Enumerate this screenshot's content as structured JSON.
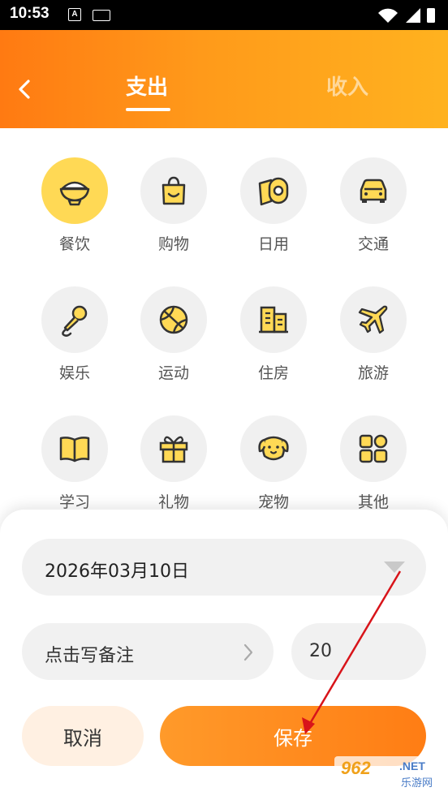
{
  "status_bar": {
    "time": "10:53",
    "a_icon": "A"
  },
  "header": {
    "tabs": [
      {
        "label": "支出",
        "active": true
      },
      {
        "label": "收入",
        "active": false
      }
    ]
  },
  "categories": [
    {
      "label": "餐饮",
      "icon": "rice-bowl-icon",
      "selected": true
    },
    {
      "label": "购物",
      "icon": "shopping-bag-icon",
      "selected": false
    },
    {
      "label": "日用",
      "icon": "toilet-paper-icon",
      "selected": false
    },
    {
      "label": "交通",
      "icon": "car-icon",
      "selected": false
    },
    {
      "label": "娱乐",
      "icon": "microphone-icon",
      "selected": false
    },
    {
      "label": "运动",
      "icon": "basketball-icon",
      "selected": false
    },
    {
      "label": "住房",
      "icon": "building-icon",
      "selected": false
    },
    {
      "label": "旅游",
      "icon": "airplane-icon",
      "selected": false
    },
    {
      "label": "学习",
      "icon": "book-icon",
      "selected": false
    },
    {
      "label": "礼物",
      "icon": "gift-icon",
      "selected": false
    },
    {
      "label": "宠物",
      "icon": "dog-icon",
      "selected": false
    },
    {
      "label": "其他",
      "icon": "grid-icon",
      "selected": false
    }
  ],
  "form": {
    "date": "2026年03月10日",
    "note_placeholder": "点击写备注",
    "amount": "20",
    "cancel_label": "取消",
    "save_label": "保存"
  },
  "watermark": {
    "number": "962",
    "domain": ".NET",
    "sub": "乐游网"
  },
  "colors": {
    "accent_orange": "#ff8a1a",
    "selected_circle": "#ffd955",
    "icon_fill": "#ffd955",
    "icon_stroke": "#333333"
  }
}
